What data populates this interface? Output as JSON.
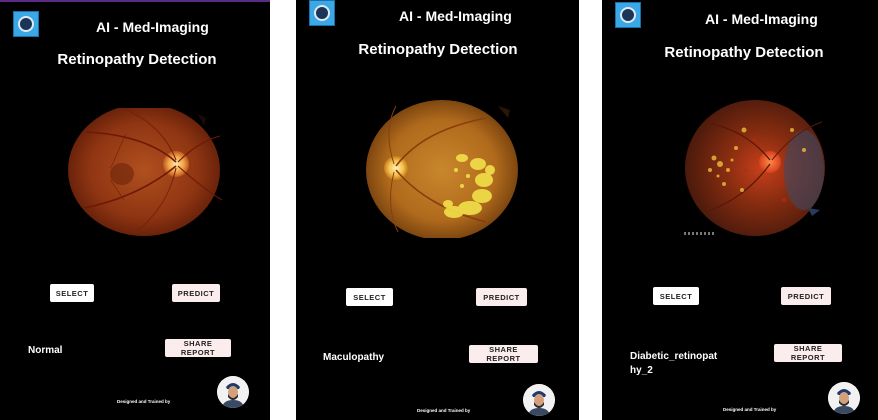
{
  "colors": {
    "background": "#000000",
    "logo": "#3aa7e6",
    "button_select": "#ffffff",
    "button_accent": "#fbecee",
    "top_border": "#5b2a86"
  },
  "screens": [
    {
      "app_title": "AI - Med-Imaging",
      "heading": "Retinopathy Detection",
      "select_label": "SELECT",
      "predict_label": "PREDICT",
      "result": "Normal",
      "share_label": "SHARE REPORT",
      "credit": "Designed and Trained by"
    },
    {
      "app_title": "AI - Med-Imaging",
      "heading": "Retinopathy Detection",
      "select_label": "SELECT",
      "predict_label": "PREDICT",
      "result": "Maculopathy",
      "share_label": "SHARE REPORT",
      "credit": "Designed and Trained by"
    },
    {
      "app_title": "AI - Med-Imaging",
      "heading": "Retinopathy Detection",
      "select_label": "SELECT",
      "predict_label": "PREDICT",
      "result": "Diabetic_retinopat hy_2",
      "share_label": "SHARE REPORT",
      "credit": "Designed and Trained by"
    }
  ]
}
